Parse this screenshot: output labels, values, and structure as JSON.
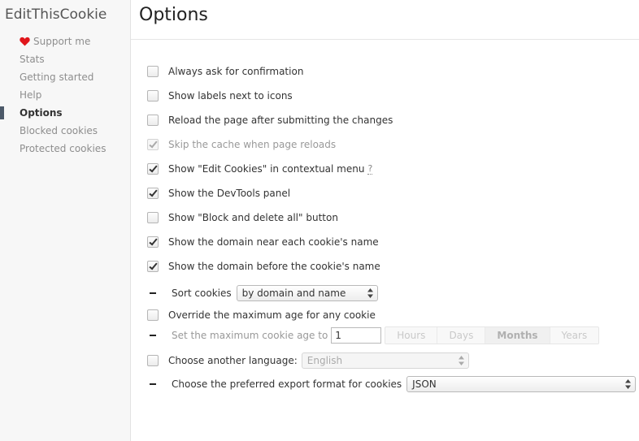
{
  "sidebar": {
    "app_title": "EditThisCookie",
    "items": [
      {
        "label": "Support me"
      },
      {
        "label": "Stats"
      },
      {
        "label": "Getting started"
      },
      {
        "label": "Help"
      },
      {
        "label": "Options"
      },
      {
        "label": "Blocked cookies"
      },
      {
        "label": "Protected cookies"
      }
    ],
    "active_item": "Options",
    "heart_color": "#e0161b",
    "active_marker_color": "#4c5969"
  },
  "main": {
    "title": "Options",
    "options": [
      {
        "label": "Always ask for confirmation",
        "checked": false,
        "disabled": false
      },
      {
        "label": "Show labels next to icons",
        "checked": false,
        "disabled": false
      },
      {
        "label": "Reload the page after submitting the changes",
        "checked": false,
        "disabled": false
      },
      {
        "label": "Skip the cache when page reloads",
        "checked": true,
        "disabled": true
      },
      {
        "label": "Show \"Edit Cookies\" in contextual menu",
        "checked": true,
        "disabled": false,
        "help": "?"
      },
      {
        "label": "Show the DevTools panel",
        "checked": true,
        "disabled": false
      },
      {
        "label": "Show \"Block and delete all\" button",
        "checked": false,
        "disabled": false
      },
      {
        "label": "Show the domain near each cookie's name",
        "checked": true,
        "disabled": false
      },
      {
        "label": "Show the domain before the cookie's name",
        "checked": true,
        "disabled": false
      }
    ],
    "sort": {
      "label": "Sort cookies",
      "value": "by domain and name"
    },
    "override_max_age": {
      "label": "Override the maximum age for any cookie",
      "checked": false
    },
    "max_age": {
      "label": "Set the maximum cookie age to",
      "value": "1",
      "units": [
        "Hours",
        "Days",
        "Months",
        "Years"
      ],
      "selected_unit": "Months"
    },
    "language": {
      "label": "Choose another language:",
      "checked": false,
      "value": "English"
    },
    "export": {
      "label": "Choose the preferred export format for cookies",
      "value": "JSON"
    }
  }
}
